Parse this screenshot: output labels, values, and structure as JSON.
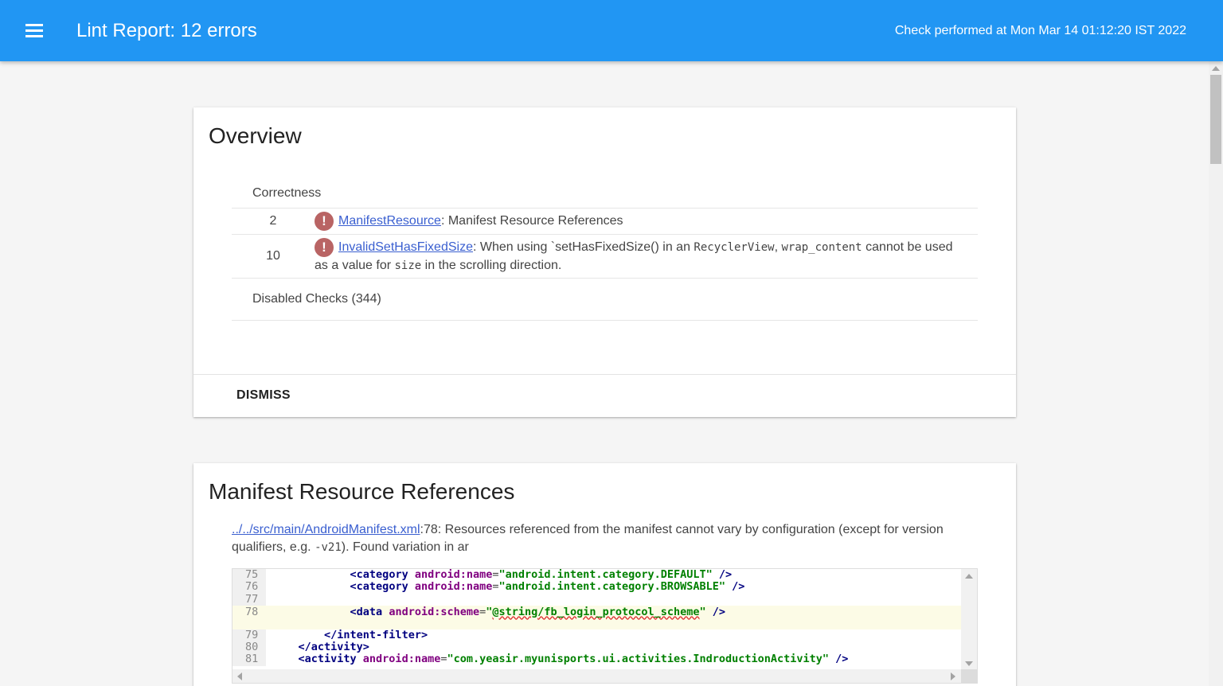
{
  "header": {
    "title": "Lint Report: 12 errors",
    "check_time": "Check performed at Mon Mar 14 01:12:20 IST 2022",
    "menu_icon": "menu-icon",
    "bg_color": "#2196f3"
  },
  "overview": {
    "title": "Overview",
    "category": "Correctness",
    "issues": [
      {
        "count": "2",
        "id": "ManifestResource",
        "desc_parts": [
          ": Manifest Resource References"
        ]
      },
      {
        "count": "10",
        "id": "InvalidSetHasFixedSize",
        "desc1": ": When using `setHasFixedSize() in an ",
        "code1": "RecyclerView",
        "desc2": ", ",
        "code2": "wrap_content",
        "desc3": " cannot be used as a value for ",
        "code3": "size",
        "desc4": " in the scrolling direction."
      }
    ],
    "disabled_checks": "Disabled Checks (344)",
    "dismiss_label": "DISMISS",
    "error_icon": "error-icon",
    "error_color": "#b96464"
  },
  "manifest_section": {
    "title": "Manifest Resource References",
    "file_link": "../../src/main/AndroidManifest.xml",
    "desc1": ":78: Resources referenced from the manifest cannot vary by configuration (except for version qualifiers, e.g. ",
    "desc_code": "-v21",
    "desc2": "). Found variation in ar",
    "code": [
      {
        "ln": "75",
        "indent": "            ",
        "tag_open": "<category ",
        "attr": "android:name",
        "eq": "=",
        "val": "\"android.intent.category.DEFAULT\"",
        "close": " />"
      },
      {
        "ln": "76",
        "indent": "            ",
        "tag_open": "<category ",
        "attr": "android:name",
        "eq": "=",
        "val": "\"android.intent.category.BROWSABLE\"",
        "close": " />"
      },
      {
        "ln": "77",
        "indent": "",
        "tag_open": "",
        "attr": "",
        "eq": "",
        "val": "",
        "close": ""
      },
      {
        "ln": "78",
        "indent": "            ",
        "tag_open": "<data ",
        "attr": "android:scheme",
        "eq": "=",
        "val_q1": "\"",
        "val_sq": "@string/fb_login_protocol_scheme",
        "val_q2": "\"",
        "close": " />"
      },
      {
        "ln": "79",
        "indent": "        ",
        "tag_open": "</intent-filter>",
        "attr": "",
        "eq": "",
        "val": "",
        "close": ""
      },
      {
        "ln": "80",
        "indent": "    ",
        "tag_open": "</activity>",
        "attr": "",
        "eq": "",
        "val": "",
        "close": ""
      },
      {
        "ln": "81",
        "indent": "    ",
        "tag_open": "<activity ",
        "attr": "android:name",
        "eq": "=",
        "val": "\"com.yeasir.myunisports.ui.activities.IndroductionActivity\"",
        "close": " />"
      }
    ]
  }
}
